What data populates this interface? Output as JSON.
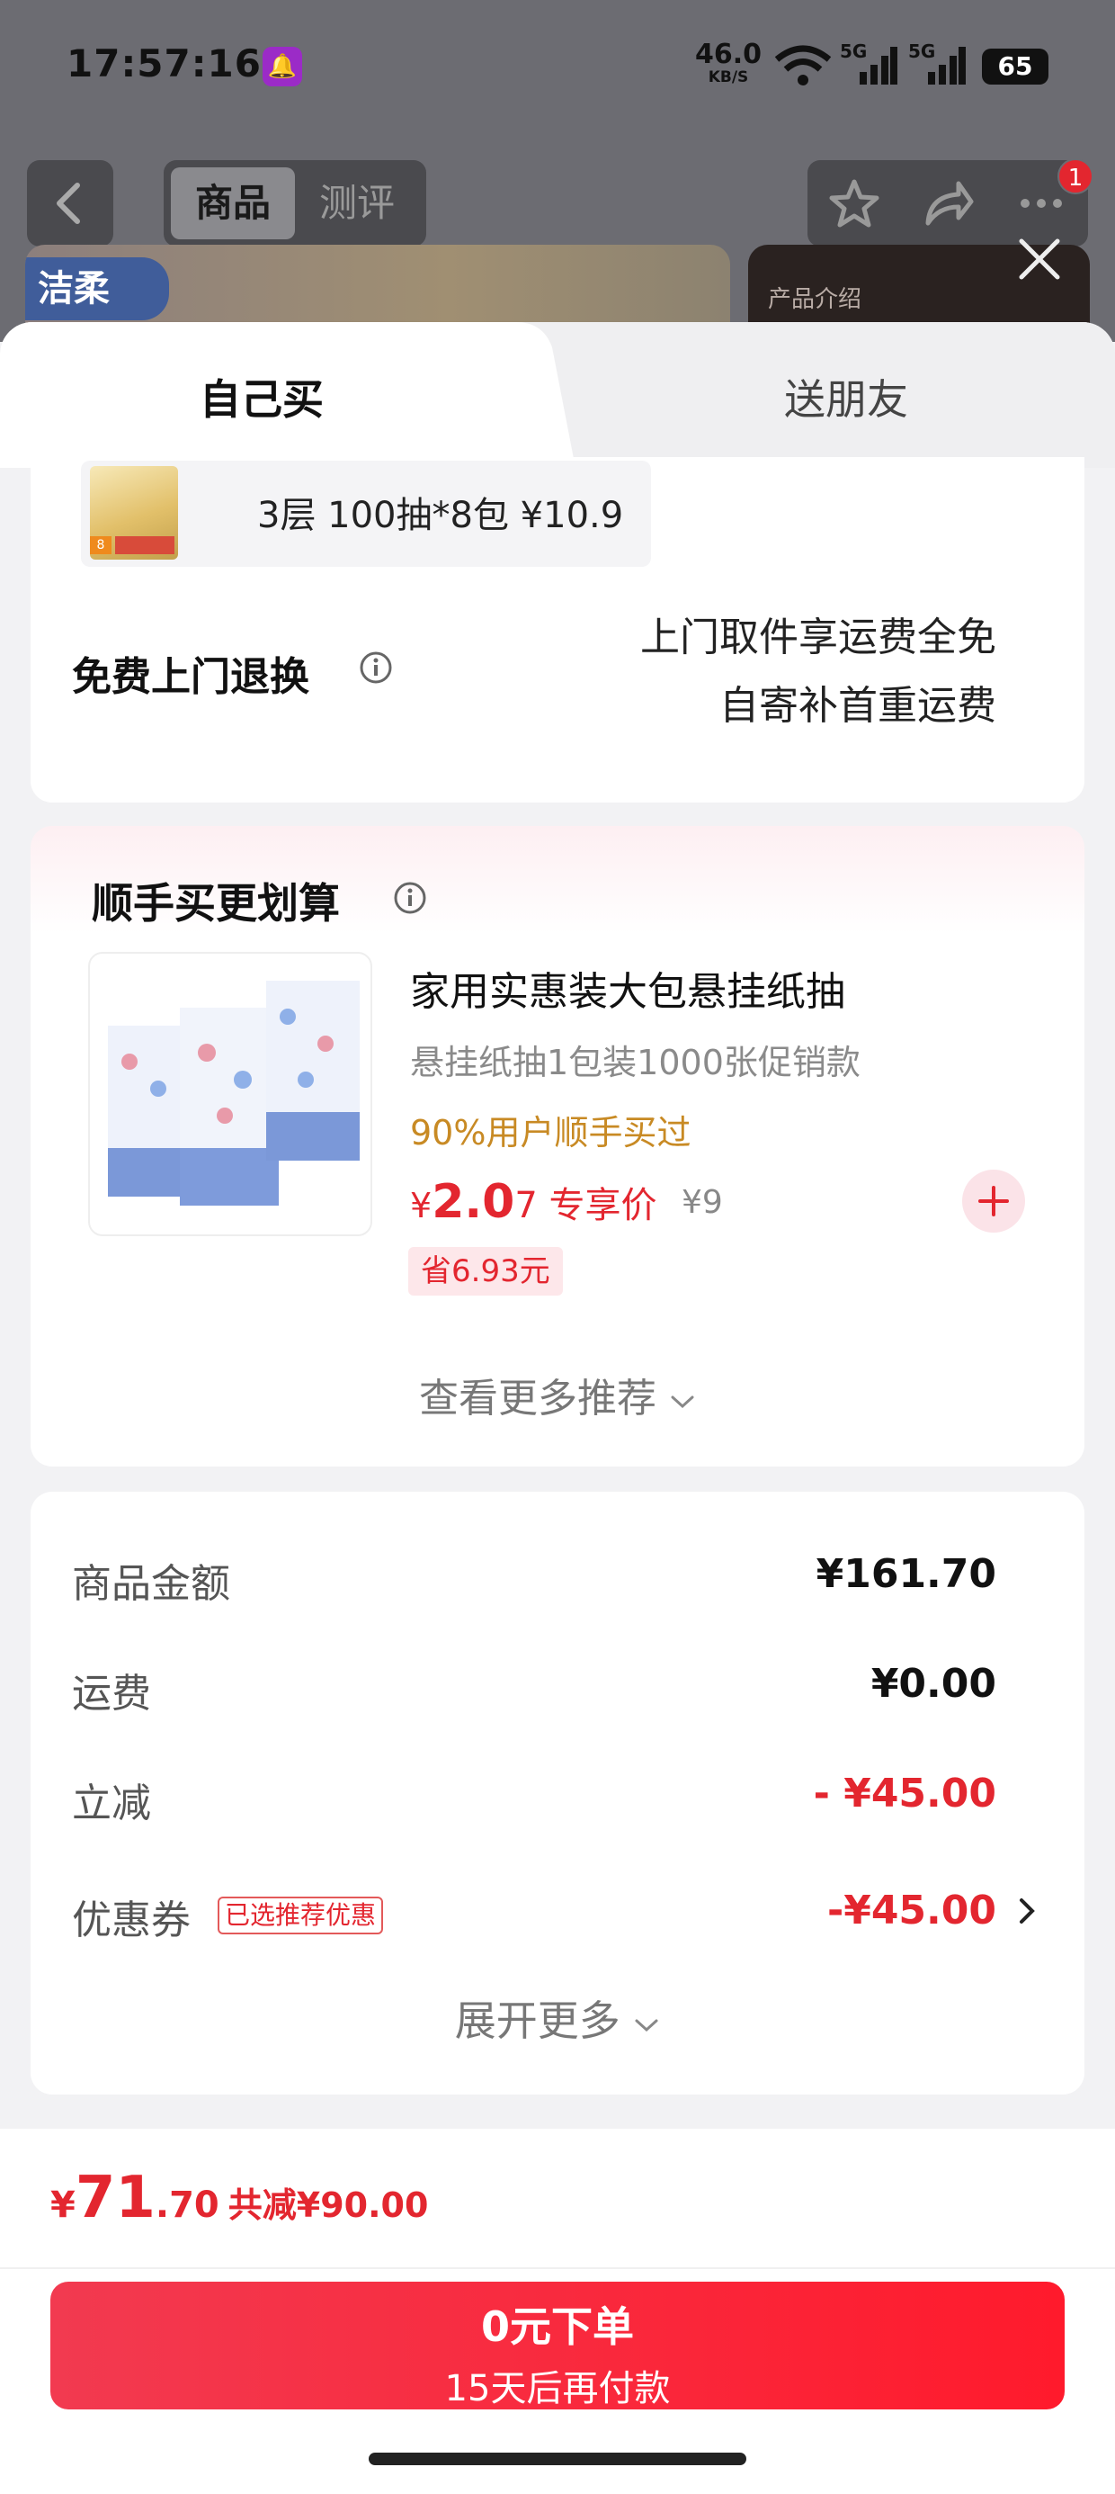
{
  "status_bar": {
    "time": "17:57:16",
    "net_speed_value": "46.0",
    "net_speed_unit": "KB/S",
    "battery": "65"
  },
  "nav": {
    "tabs": [
      "商品",
      "测评"
    ],
    "active_tab": 0,
    "cart_badge": "1"
  },
  "banner": {
    "brand": "洁柔",
    "right_label": "产品介绍"
  },
  "sheet": {
    "tabs": {
      "self": "自己买",
      "friend": "送朋友"
    },
    "sku": {
      "text": "3层 100抽*8包  ¥10.9"
    },
    "return": {
      "title": "免费上门退换",
      "line1": "上门取件享运费全免",
      "line2": "自寄补首重运费"
    }
  },
  "recommend": {
    "title": "顺手买更划算",
    "product": {
      "name": "家用实惠装大包悬挂纸抽",
      "subtitle": "悬挂纸抽1包装1000张促销款",
      "hot": "90%用户顺手买过",
      "price_symbol": "¥",
      "price_main": "2.0",
      "price_suffix": "7 专享价",
      "original_price": "¥9",
      "save_tag": "省6.93元"
    },
    "more_label": "查看更多推荐"
  },
  "summary": {
    "rows": [
      {
        "label": "商品金额",
        "value": "¥161.70"
      },
      {
        "label": "运费",
        "value": "¥0.00"
      },
      {
        "label": "立减",
        "value": "- ¥45.00"
      },
      {
        "label": "优惠券",
        "value": "-¥45.00",
        "tag": "已选推荐优惠"
      }
    ],
    "expand_label": "展开更多"
  },
  "footer": {
    "total_symbol": "¥",
    "total_int": "71",
    "total_dec": ".70",
    "total_saved": "共减¥90.00",
    "cta_main": "0元下单",
    "cta_sub": "15天后再付款"
  },
  "colors": {
    "accent_red": "#e3262f",
    "hot_orange": "#c88a24",
    "cta_gradient_start": "#f23a50",
    "cta_gradient_end": "#ff1a2c"
  }
}
